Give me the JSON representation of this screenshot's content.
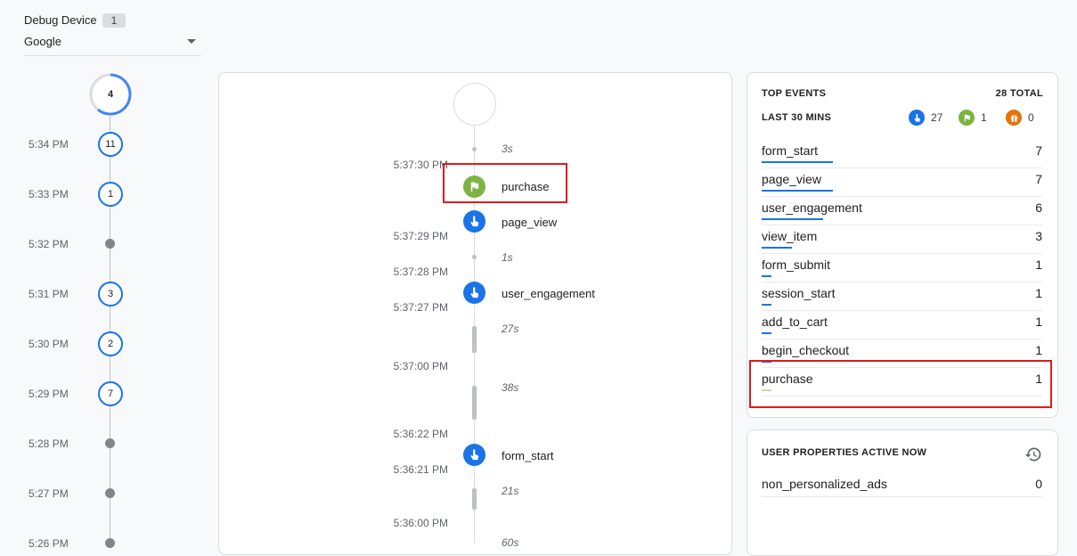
{
  "device": {
    "label": "Debug Device",
    "count": "1",
    "selected": "Google"
  },
  "minutes": {
    "current_count": "4",
    "rows": [
      {
        "time": "5:34 PM",
        "count": "11"
      },
      {
        "time": "5:33 PM",
        "count": "1"
      },
      {
        "time": "5:32 PM",
        "count": ""
      },
      {
        "time": "5:31 PM",
        "count": "3"
      },
      {
        "time": "5:30 PM",
        "count": "2"
      },
      {
        "time": "5:29 PM",
        "count": "7"
      },
      {
        "time": "5:28 PM",
        "count": ""
      },
      {
        "time": "5:27 PM",
        "count": ""
      },
      {
        "time": "5:26 PM",
        "count": ""
      }
    ]
  },
  "seconds": {
    "times": [
      "5:37:30 PM",
      "5:37:29 PM",
      "5:37:28 PM",
      "5:37:27 PM",
      "5:37:00 PM",
      "5:36:22 PM",
      "5:36:21 PM",
      "5:36:00 PM"
    ],
    "gaps": [
      "3s",
      "1s",
      "27s",
      "38s",
      "21s",
      "60s"
    ],
    "events": [
      {
        "name": "purchase",
        "type": "conversion",
        "color": "#7cb342"
      },
      {
        "name": "page_view",
        "type": "event",
        "color": "#1a73e8"
      },
      {
        "name": "user_engagement",
        "type": "event",
        "color": "#1a73e8"
      },
      {
        "name": "form_start",
        "type": "event",
        "color": "#1a73e8"
      }
    ]
  },
  "top_events": {
    "title": "TOP EVENTS",
    "total": "28 TOTAL",
    "period": "LAST 30 MINS",
    "summary": [
      {
        "icon": "touch-icon",
        "color": "#1a73e8",
        "value": "27"
      },
      {
        "icon": "flag-icon",
        "color": "#7cb342",
        "value": "1"
      },
      {
        "icon": "gift-icon",
        "color": "#e8710a",
        "value": "0"
      }
    ],
    "rows": [
      {
        "name": "form_start",
        "count": "7",
        "fraction": 1.0
      },
      {
        "name": "page_view",
        "count": "7",
        "fraction": 1.0
      },
      {
        "name": "user_engagement",
        "count": "6",
        "fraction": 0.86
      },
      {
        "name": "view_item",
        "count": "3",
        "fraction": 0.43
      },
      {
        "name": "form_submit",
        "count": "1",
        "fraction": 0.14
      },
      {
        "name": "session_start",
        "count": "1",
        "fraction": 0.14
      },
      {
        "name": "add_to_cart",
        "count": "1",
        "fraction": 0.14
      },
      {
        "name": "begin_checkout",
        "count": "1",
        "fraction": 0.14
      },
      {
        "name": "purchase",
        "count": "1",
        "fraction": 0.14
      }
    ]
  },
  "user_properties": {
    "title": "USER PROPERTIES ACTIVE NOW",
    "rows": [
      {
        "name": "non_personalized_ads",
        "value": "0"
      }
    ]
  },
  "colors": {
    "accent": "#1a73e8",
    "conversion": "#7cb342",
    "highlight": "#e01b1b"
  }
}
